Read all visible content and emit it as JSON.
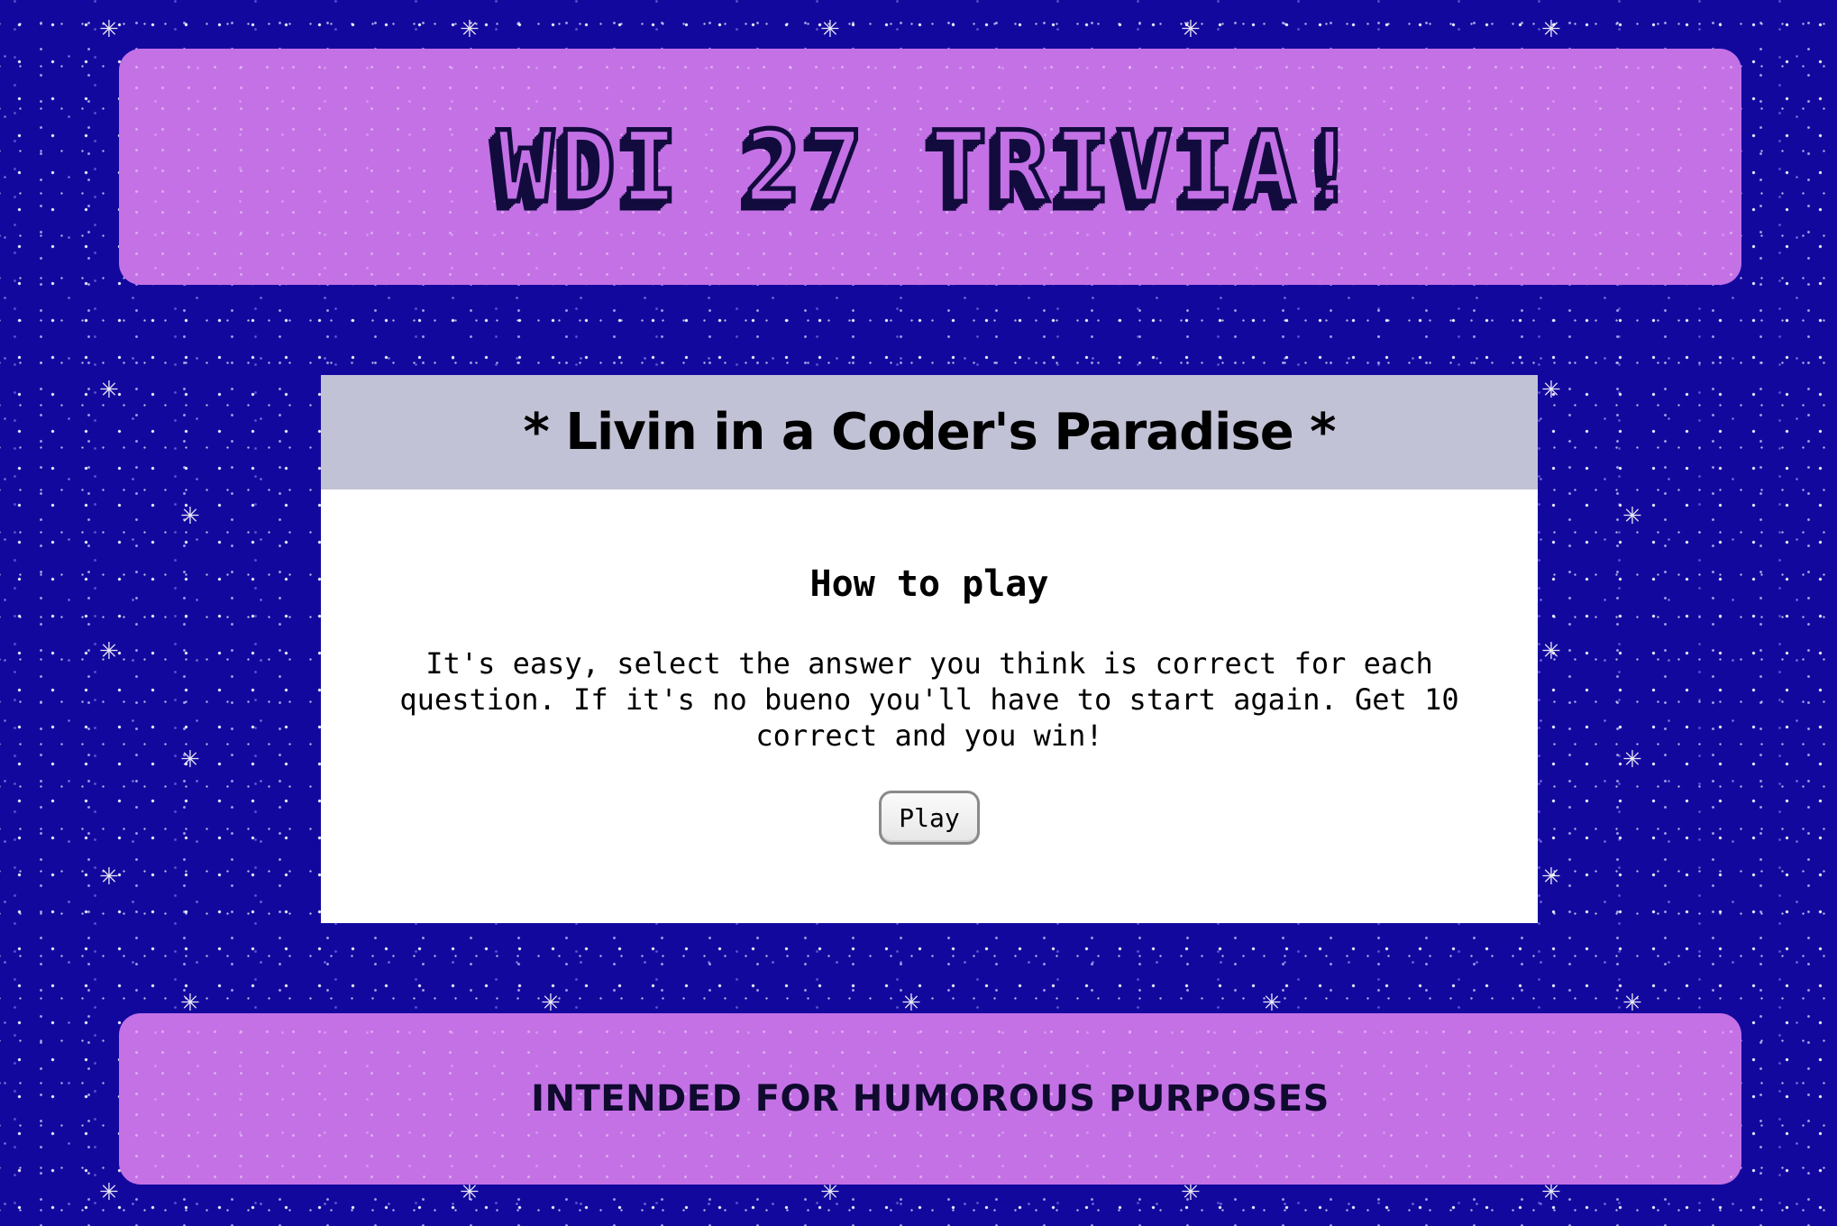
{
  "header": {
    "title": "WDI 27 TRIVIA!"
  },
  "card": {
    "heading": "* Livin in a Coder's Paradise *",
    "how_to_play_heading": "How to play",
    "instructions": "It's easy, select the answer you think is correct for each question. If it's no bueno you'll have to start again. Get 10 correct and you win!",
    "play_label": "Play"
  },
  "footer": {
    "text": "INTENDED FOR HUMOROUS PURPOSES"
  },
  "colors": {
    "background": "#13089e",
    "panel": "#c471e6",
    "card_header": "#c2c2d6",
    "card_body": "#ffffff",
    "title_outline": "#120b3d"
  },
  "icons": {
    "decoration": "sparkle-icon"
  }
}
